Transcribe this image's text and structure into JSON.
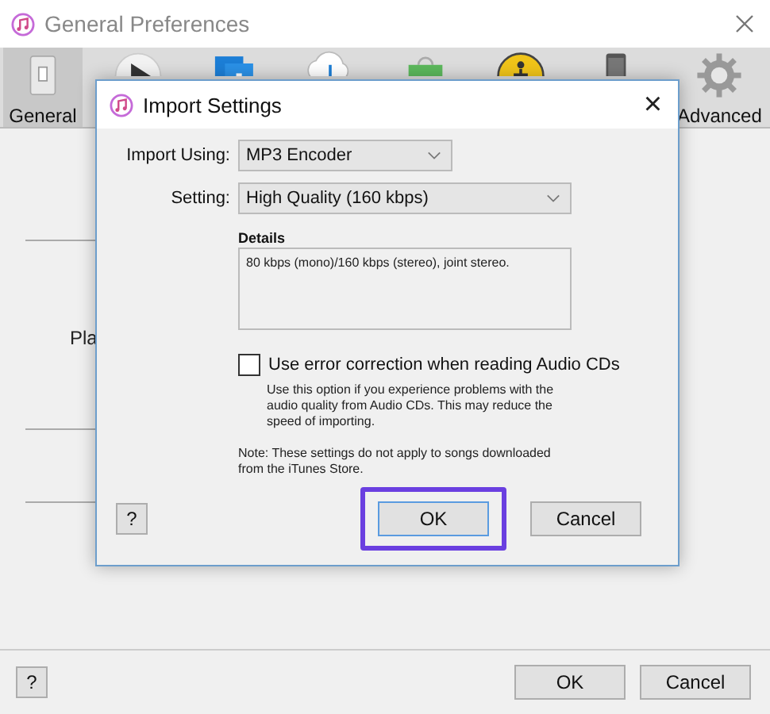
{
  "window": {
    "title": "General Preferences"
  },
  "toolbar": [
    {
      "kind": "general",
      "label": "General",
      "selected": true
    },
    {
      "kind": "playback",
      "selected": false
    },
    {
      "kind": "sharing",
      "selected": false
    },
    {
      "kind": "cloud",
      "selected": false
    },
    {
      "kind": "store",
      "selected": false
    },
    {
      "kind": "restrictions",
      "selected": false
    },
    {
      "kind": "devices",
      "selected": false
    },
    {
      "kind": "advanced",
      "label": "Advanced",
      "selected": false
    }
  ],
  "background_label": "Pla",
  "footer": {
    "help": "?",
    "buttons": [
      "OK",
      "Cancel"
    ]
  },
  "dialog": {
    "title": "Import Settings",
    "close": "×",
    "import_using": {
      "label": "Import Using:",
      "value": "MP3 Encoder"
    },
    "setting": {
      "label": "Setting:",
      "value": "High Quality (160 kbps)"
    },
    "details": {
      "label": "Details",
      "text": "80 kbps (mono)/160 kbps (stereo), joint stereo."
    },
    "error_correction": {
      "label": "Use error correction when reading Audio CDs",
      "checked": false,
      "help": "Use this option if you experience problems with the audio quality from Audio CDs.  This may reduce the speed of importing."
    },
    "note": "Note: These settings do not apply to songs downloaded from the iTunes Store.",
    "help": "?",
    "buttons": [
      {
        "label": "OK",
        "highlighted": true
      },
      {
        "label": "Cancel",
        "highlighted": false
      }
    ]
  }
}
